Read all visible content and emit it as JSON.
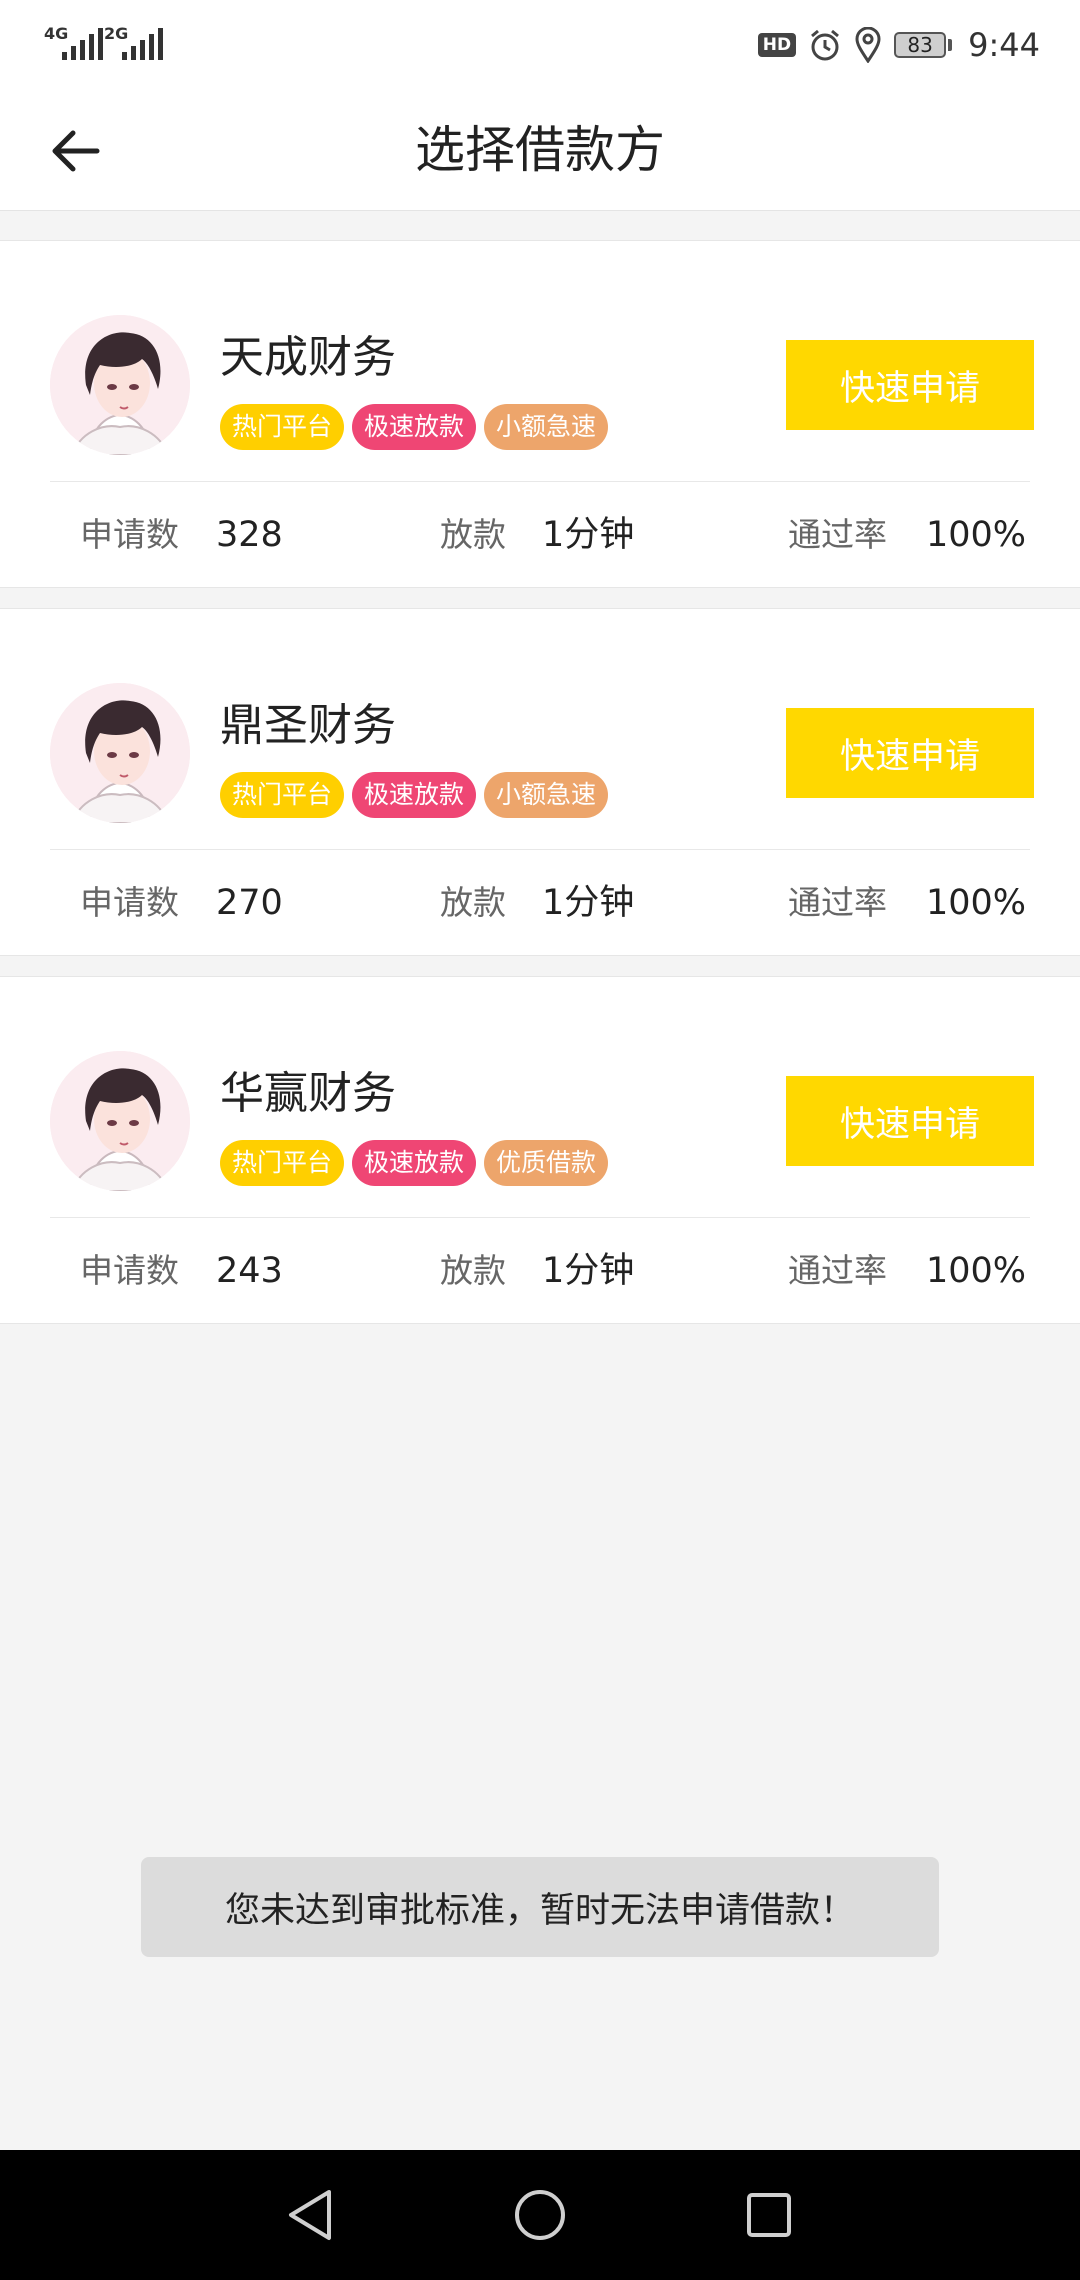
{
  "status_bar": {
    "network1": "4G",
    "network2": "2G",
    "hd": "HD",
    "battery": "83",
    "time": "9:44"
  },
  "header": {
    "title": "选择借款方"
  },
  "lenders": [
    {
      "name": "天成财务",
      "tags": [
        "热门平台",
        "极速放款",
        "小额急速"
      ],
      "apply_label": "快速申请",
      "applications_label": "申请数",
      "applications": "328",
      "disburse_label": "放款",
      "disburse": "1分钟",
      "pass_rate_label": "通过率",
      "pass_rate": "100%"
    },
    {
      "name": "鼎圣财务",
      "tags": [
        "热门平台",
        "极速放款",
        "小额急速"
      ],
      "apply_label": "快速申请",
      "applications_label": "申请数",
      "applications": "270",
      "disburse_label": "放款",
      "disburse": "1分钟",
      "pass_rate_label": "通过率",
      "pass_rate": "100%"
    },
    {
      "name": "华赢财务",
      "tags": [
        "热门平台",
        "极速放款",
        "优质借款"
      ],
      "apply_label": "快速申请",
      "applications_label": "申请数",
      "applications": "243",
      "disburse_label": "放款",
      "disburse": "1分钟",
      "pass_rate_label": "通过率",
      "pass_rate": "100%"
    }
  ],
  "toast": {
    "message": "您未达到审批标准，暂时无法申请借款！"
  },
  "colors": {
    "accent": "#ffd800",
    "tag_hot": "#ffcf00",
    "tag_fast": "#ef4674",
    "tag_small": "#eda56b"
  },
  "icons": {
    "back": "arrow-left-icon",
    "nav_back": "triangle-back-icon",
    "nav_home": "circle-home-icon",
    "nav_recents": "square-recents-icon"
  }
}
